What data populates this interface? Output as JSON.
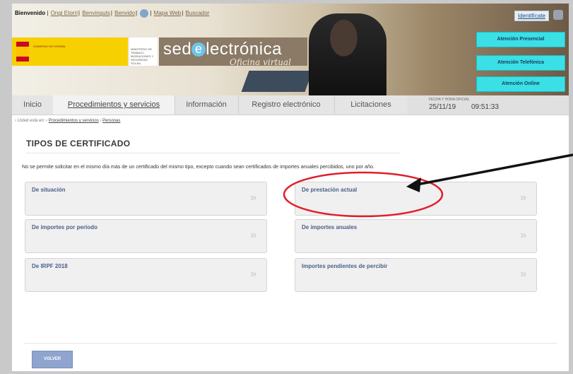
{
  "header": {
    "welcome": "Bienvenido",
    "links": [
      "Ongi Etorri",
      "Benvinguts",
      "Benvido"
    ],
    "map_link": "Mapa Web",
    "search_link": "Buscador",
    "identify": "Identifícate",
    "logo_main_prefix": "sed",
    "logo_main_e": "e",
    "logo_main_suffix": "lectrónica",
    "logo_sub": "Oficina virtual",
    "gov_text": "GOBIERNO DE ESPAÑA",
    "ministry_text": "MINISTERIO DE TRABAJO, MIGRACIONES Y SEGURIDAD SOCIAL",
    "side_buttons": [
      "Atención Presencial",
      "Atención Telefónica",
      "Atención Online"
    ]
  },
  "nav": {
    "tabs": [
      "Inicio",
      "Procedimientos y servicios",
      "Información",
      "Registro electrónico",
      "Licitaciones"
    ],
    "clock_label": "FECHA Y HORA OFICIAL",
    "date": "25/11/19",
    "time": "09:51:33"
  },
  "breadcrumb": {
    "prefix": "› Usted está en:",
    "items": [
      "Procedimientos y servicios",
      "Personas"
    ]
  },
  "main": {
    "title": "TIPOS DE CERTIFICADO",
    "notice": "No se permite solicitar en el mismo día más de un certificado del mismo tipo, excepto cuando sean certificados de importes anuales percibidos, uno por año.",
    "cards": [
      "De situación",
      "De prestación actual",
      "De importes por periodo",
      "De importes anuales",
      "De IRPF 2018",
      "Importes pendientes de percibir"
    ],
    "arrow_glyph": "»",
    "back_button": "VOLVER"
  },
  "colors": {
    "accent_cyan": "#3ae0e6",
    "annotation_red": "#e0202a",
    "card_label": "#4a5f88"
  }
}
